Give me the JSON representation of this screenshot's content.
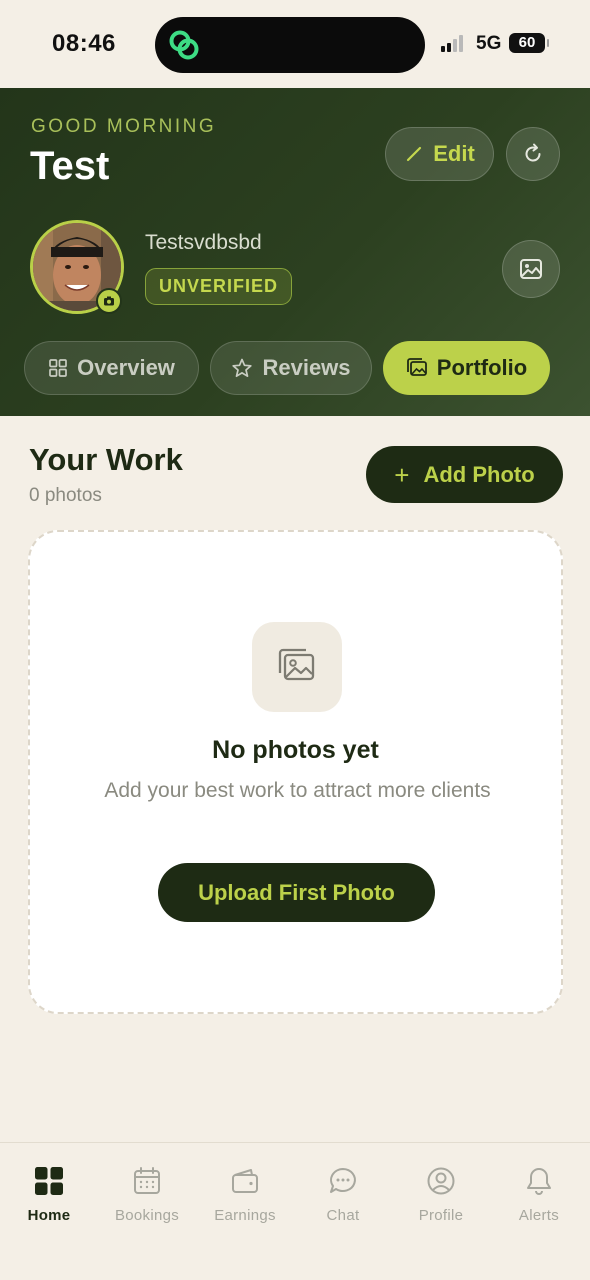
{
  "status_bar": {
    "time": "08:46",
    "network": "5G",
    "battery": "60"
  },
  "header": {
    "greeting": "GOOD MORNING",
    "title": "Test",
    "edit_label": "Edit",
    "username": "Testsvdbsbd",
    "badge": "UNVERIFIED"
  },
  "tabs": [
    {
      "label": "Overview",
      "icon": "grid-icon",
      "active": false
    },
    {
      "label": "Reviews",
      "icon": "star-icon",
      "active": false
    },
    {
      "label": "Portfolio",
      "icon": "images-icon",
      "active": true
    }
  ],
  "main": {
    "section_title": "Your Work",
    "photo_count": "0 photos",
    "add_photo_label": "Add Photo",
    "empty_title": "No photos yet",
    "empty_desc": "Add your best work to attract more clients",
    "upload_label": "Upload First Photo"
  },
  "bottom_nav": [
    {
      "label": "Home",
      "icon": "home-grid-icon",
      "active": true
    },
    {
      "label": "Bookings",
      "icon": "calendar-icon",
      "active": false
    },
    {
      "label": "Earnings",
      "icon": "wallet-icon",
      "active": false
    },
    {
      "label": "Chat",
      "icon": "chat-bubble-icon",
      "active": false
    },
    {
      "label": "Profile",
      "icon": "user-circle-icon",
      "active": false
    },
    {
      "label": "Alerts",
      "icon": "bell-icon",
      "active": false
    }
  ],
  "colors": {
    "accent": "#BCD14A",
    "header_dark": "#23351A",
    "button_dark": "#1E2B14",
    "background": "#F4EFE6"
  }
}
